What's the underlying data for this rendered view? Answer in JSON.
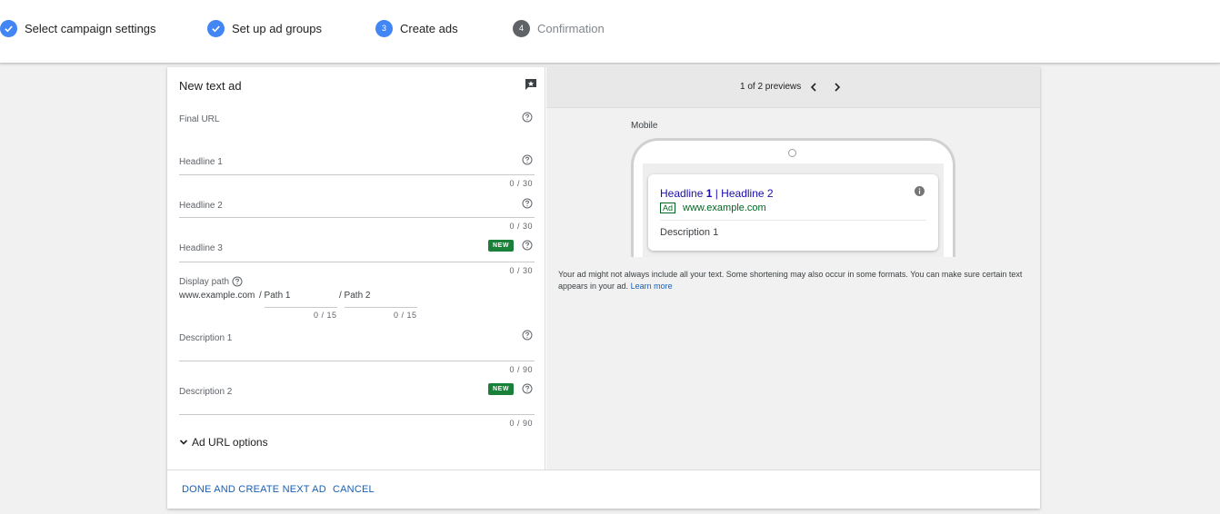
{
  "stepper": {
    "steps": [
      {
        "label": "Select campaign settings",
        "state": "done"
      },
      {
        "label": "Set up ad groups",
        "state": "done"
      },
      {
        "label": "Create ads",
        "number": "3",
        "state": "active"
      },
      {
        "label": "Confirmation",
        "number": "4",
        "state": "pending"
      }
    ]
  },
  "form": {
    "title": "New text ad",
    "final_url": {
      "label": "Final URL"
    },
    "headline1": {
      "label": "Headline 1",
      "counter": "0 / 30"
    },
    "headline2": {
      "label": "Headline 2",
      "counter": "0 / 30"
    },
    "headline3": {
      "label": "Headline 3",
      "counter": "0 / 30",
      "badge": "NEW"
    },
    "display_path": {
      "label": "Display path",
      "domain": "www.example.com",
      "path1_placeholder": "/ Path 1",
      "path2_placeholder": "/ Path 2",
      "path1_counter": "0 / 15",
      "path2_counter": "0 / 15"
    },
    "description1": {
      "label": "Description 1",
      "counter": "0 / 90"
    },
    "description2": {
      "label": "Description 2",
      "counter": "0 / 90",
      "badge": "NEW"
    },
    "url_options": "Ad URL options"
  },
  "footer": {
    "done_label": "DONE AND CREATE NEXT AD",
    "cancel_label": "CANCEL"
  },
  "preview": {
    "count": "1 of 2 previews",
    "device_label": "Mobile",
    "ad": {
      "headline_part1": "Headline ",
      "headline_bold": "1",
      "headline_part2": " | Headline 2",
      "tag": "Ad",
      "url": "www.example.com",
      "description": "Description 1"
    },
    "disclaimer": "Your ad might not always include all your text. Some shortening may also occur in some formats. You can make sure certain text appears in your ad.",
    "learn_more": "Learn more"
  },
  "colors": {
    "accent": "#4285f4",
    "badge_green": "#188038",
    "link_blue": "#1a5fb4",
    "ad_headline": "#1a0dab",
    "ad_url": "#006621"
  }
}
